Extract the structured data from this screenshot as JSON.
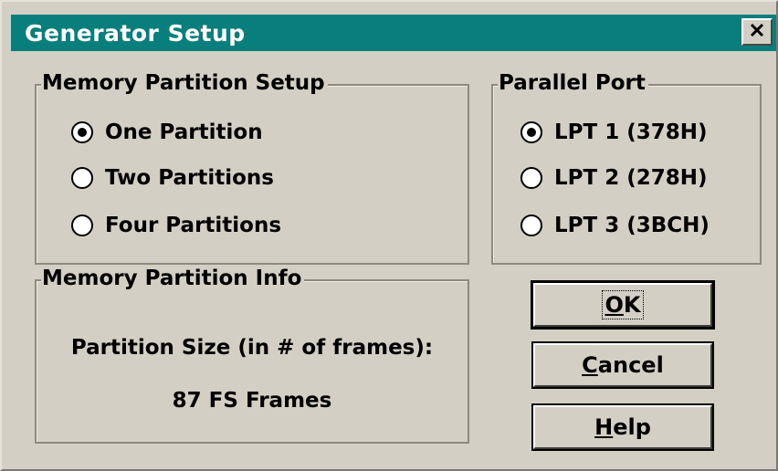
{
  "window": {
    "title": "Generator Setup",
    "close_icon": "close-icon",
    "colors": {
      "title_bar": "#087f7c",
      "window_face": "#d4cfc4"
    }
  },
  "memory_partition_setup": {
    "label": "Memory Partition Setup",
    "options": [
      {
        "label": "One Partition",
        "selected": true
      },
      {
        "label": "Two Partitions",
        "selected": false
      },
      {
        "label": "Four Partitions",
        "selected": false
      }
    ]
  },
  "parallel_port": {
    "label": "Parallel Port",
    "options": [
      {
        "label": "LPT 1 (378H)",
        "selected": true
      },
      {
        "label": "LPT 2 (278H)",
        "selected": false
      },
      {
        "label": "LPT 3 (3BCH)",
        "selected": false
      }
    ]
  },
  "memory_partition_info": {
    "label": "Memory Partition Info",
    "size_label": "Partition Size (in # of frames):",
    "size_value": "87 FS Frames"
  },
  "buttons": {
    "ok": "OK",
    "cancel": "Cancel",
    "help": "Help"
  }
}
